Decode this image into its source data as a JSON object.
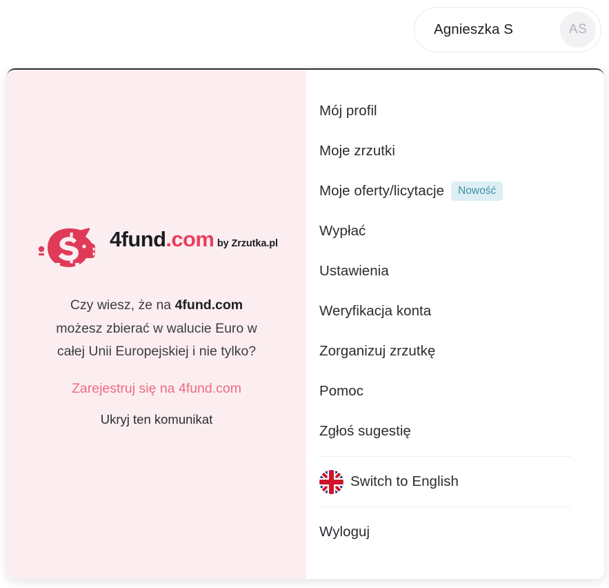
{
  "account": {
    "name": "Agnieszka S",
    "initials": "AS"
  },
  "promo": {
    "logo": {
      "mark_icon": "piggy-bank-icon",
      "wordmark_main": "4fund",
      "wordmark_tld": ".com",
      "subtitle": "by Zrzutka.pl"
    },
    "line1_prefix": "Czy wiesz, że na ",
    "line1_brand": "4fund.com",
    "line2": "możesz zbierać w walucie Euro w",
    "line3": "całej Unii Europejskiej i nie tylko?",
    "cta_link": "Zarejestruj się na 4fund.com",
    "dismiss_link": "Ukryj ten komunikat"
  },
  "menu": {
    "items": [
      {
        "label": "Mój profil"
      },
      {
        "label": "Moje zrzutki"
      },
      {
        "label": "Moje oferty/licytacje",
        "badge": "Nowość",
        "highlighted": true
      },
      {
        "label": "Wypłać"
      },
      {
        "label": "Ustawienia"
      },
      {
        "label": "Weryfikacja konta"
      },
      {
        "label": "Zorganizuj zrzutkę"
      },
      {
        "label": "Pomoc"
      },
      {
        "label": "Zgłoś sugestię"
      }
    ],
    "language_item": {
      "label": "Switch to English",
      "icon": "uk-flag-icon"
    },
    "logout_item": {
      "label": "Wyloguj"
    }
  },
  "colors": {
    "accent_pink": "#e93f5e",
    "promo_bg": "#fceef0",
    "highlight_border": "#d93a5c",
    "badge_bg": "#ddeff5",
    "badge_text": "#3f8fa2"
  }
}
